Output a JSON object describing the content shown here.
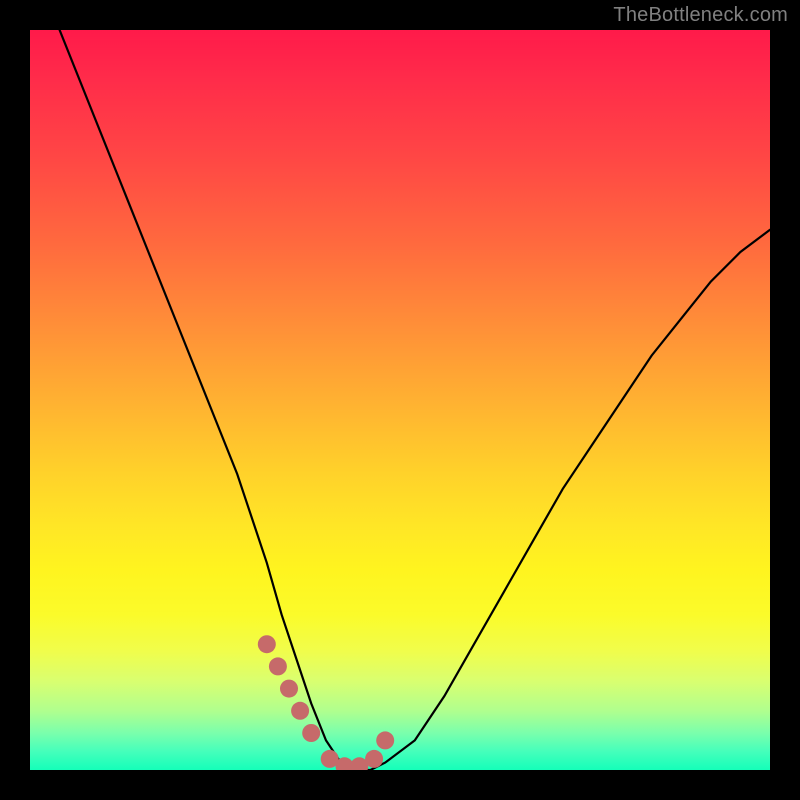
{
  "watermark": "TheBottleneck.com",
  "chart_data": {
    "type": "line",
    "title": "",
    "xlabel": "",
    "ylabel": "",
    "xlim": [
      0,
      100
    ],
    "ylim": [
      0,
      100
    ],
    "grid": false,
    "series": [
      {
        "name": "bottleneck-curve",
        "x": [
          4,
          8,
          12,
          16,
          20,
          24,
          28,
          32,
          34,
          36,
          38,
          40,
          42,
          44,
          46,
          48,
          52,
          56,
          60,
          64,
          68,
          72,
          76,
          80,
          84,
          88,
          92,
          96,
          100
        ],
        "y": [
          100,
          90,
          80,
          70,
          60,
          50,
          40,
          28,
          21,
          15,
          9,
          4,
          1,
          0,
          0,
          1,
          4,
          10,
          17,
          24,
          31,
          38,
          44,
          50,
          56,
          61,
          66,
          70,
          73
        ]
      }
    ],
    "markers": {
      "name": "highlight-points",
      "color": "#c66a6a",
      "x": [
        32,
        33.5,
        35,
        36.5,
        38,
        40.5,
        42.5,
        44.5,
        46.5,
        48
      ],
      "y": [
        17,
        14,
        11,
        8,
        5,
        1.5,
        0.5,
        0.5,
        1.5,
        4
      ]
    }
  }
}
